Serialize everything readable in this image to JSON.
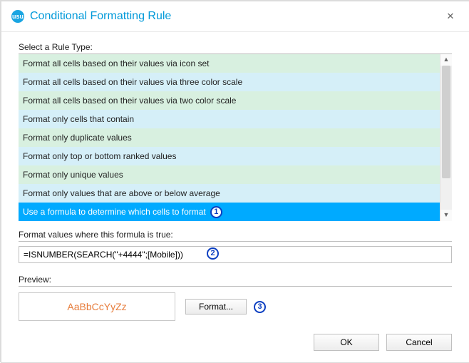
{
  "window": {
    "title": "Conditional Formatting Rule",
    "app_icon_text": "usu"
  },
  "labels": {
    "select_rule_type": "Select a Rule Type:",
    "formula_label": "Format values where this formula is true:",
    "preview_label": "Preview:"
  },
  "rule_types": {
    "items": [
      "Format all cells based on their values via icon set",
      "Format all cells based on their values via three color scale",
      "Format all cells based on their values via two color scale",
      "Format only cells that contain",
      "Format only duplicate values",
      "Format only top or bottom ranked values",
      "Format only unique values",
      "Format only values that are above or below average",
      "Use a formula to determine which cells to format"
    ],
    "selected_index": 8
  },
  "formula": {
    "value": "=ISNUMBER(SEARCH(\"+4444\";[Mobile]))"
  },
  "preview": {
    "sample_text": "AaBbCcYyZz",
    "color": "#e77c3b"
  },
  "buttons": {
    "format": "Format...",
    "ok": "OK",
    "cancel": "Cancel"
  },
  "callouts": {
    "one": "1",
    "two": "2",
    "three": "3"
  }
}
